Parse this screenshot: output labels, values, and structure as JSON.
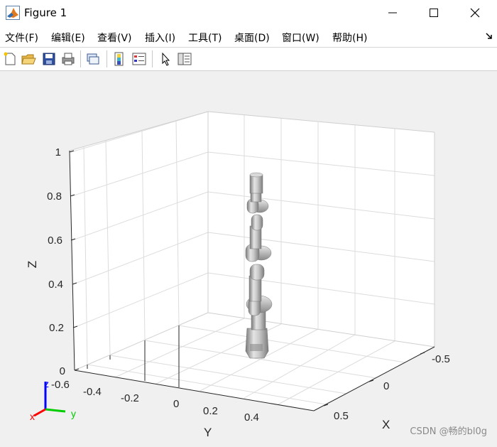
{
  "window": {
    "title": "Figure 1",
    "minimize_icon": "minimize-icon",
    "maximize_icon": "maximize-icon",
    "close_icon": "close-icon"
  },
  "menu": {
    "items": [
      {
        "label": "文件(F)"
      },
      {
        "label": "编辑(E)"
      },
      {
        "label": "查看(V)"
      },
      {
        "label": "插入(I)"
      },
      {
        "label": "工具(T)"
      },
      {
        "label": "桌面(D)"
      },
      {
        "label": "窗口(W)"
      },
      {
        "label": "帮助(H)"
      }
    ],
    "dock_icon": "dock-arrow-icon"
  },
  "toolbar": {
    "buttons": [
      {
        "icon": "new-figure-icon"
      },
      {
        "icon": "open-file-icon"
      },
      {
        "icon": "save-icon"
      },
      {
        "icon": "print-icon"
      },
      {
        "icon": "link-plot-icon"
      },
      {
        "icon": "colorbar-icon"
      },
      {
        "icon": "legend-icon"
      },
      {
        "icon": "edit-plot-arrow-icon"
      },
      {
        "icon": "property-inspector-icon"
      }
    ]
  },
  "plot": {
    "z_label": "Z",
    "y_label": "Y",
    "x_label": "X",
    "z_ticks": [
      "0",
      "0.2",
      "0.4",
      "0.6",
      "0.8",
      "1"
    ],
    "y_ticks": [
      "-0.6",
      "-0.4",
      "-0.2",
      "0",
      "0.2",
      "0.4"
    ],
    "x_ticks": [
      "-0.5",
      "0",
      "0.5"
    ],
    "triad": {
      "x": "x",
      "y": "y",
      "z": "z"
    }
  },
  "watermark": "CSDN @畅的bl0g"
}
